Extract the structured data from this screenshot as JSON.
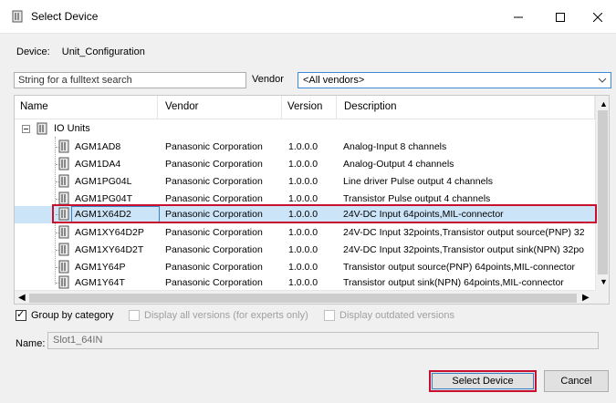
{
  "window": {
    "title": "Select Device"
  },
  "device": {
    "label": "Device:",
    "value": "Unit_Configuration"
  },
  "search": {
    "placeholder": "String for a fulltext search"
  },
  "vendor": {
    "label": "Vendor",
    "selected": "<All vendors>"
  },
  "table": {
    "columns": [
      "Name",
      "Vendor",
      "Version",
      "Description"
    ],
    "group": "IO Units",
    "rows": [
      {
        "name": "AGM1AD8",
        "vendor": "Panasonic Corporation",
        "version": "1.0.0.0",
        "description": "Analog-Input 8 channels"
      },
      {
        "name": "AGM1DA4",
        "vendor": "Panasonic Corporation",
        "version": "1.0.0.0",
        "description": "Analog-Output 4 channels"
      },
      {
        "name": "AGM1PG04L",
        "vendor": "Panasonic Corporation",
        "version": "1.0.0.0",
        "description": "Line driver Pulse output 4 channels"
      },
      {
        "name": "AGM1PG04T",
        "vendor": "Panasonic Corporation",
        "version": "1.0.0.0",
        "description": "Transistor Pulse output 4 channels"
      },
      {
        "name": "AGM1X64D2",
        "vendor": "Panasonic Corporation",
        "version": "1.0.0.0",
        "description": "24V-DC Input 64points,MIL-connector",
        "selected": true
      },
      {
        "name": "AGM1XY64D2P",
        "vendor": "Panasonic Corporation",
        "version": "1.0.0.0",
        "description": "24V-DC Input 32points,Transistor output source(PNP) 32"
      },
      {
        "name": "AGM1XY64D2T",
        "vendor": "Panasonic Corporation",
        "version": "1.0.0.0",
        "description": "24V-DC Input 32points,Transistor output sink(NPN) 32po"
      },
      {
        "name": "AGM1Y64P",
        "vendor": "Panasonic Corporation",
        "version": "1.0.0.0",
        "description": "Transistor output source(PNP) 64points,MIL-connector"
      },
      {
        "name": "AGM1Y64T",
        "vendor": "Panasonic Corporation",
        "version": "1.0.0.0",
        "description": "Transistor output sink(NPN) 64points,MIL-connector"
      }
    ]
  },
  "options": {
    "group_by_category": "Group by category",
    "display_all_versions": "Display all versions (for experts only)",
    "display_outdated": "Display outdated versions"
  },
  "name_field": {
    "label": "Name:",
    "value": "Slot1_64IN"
  },
  "buttons": {
    "select": "Select Device",
    "cancel": "Cancel"
  },
  "colors": {
    "selection": "#cce4f7",
    "highlight": "#c8102e",
    "accent": "#3b7fc4"
  }
}
